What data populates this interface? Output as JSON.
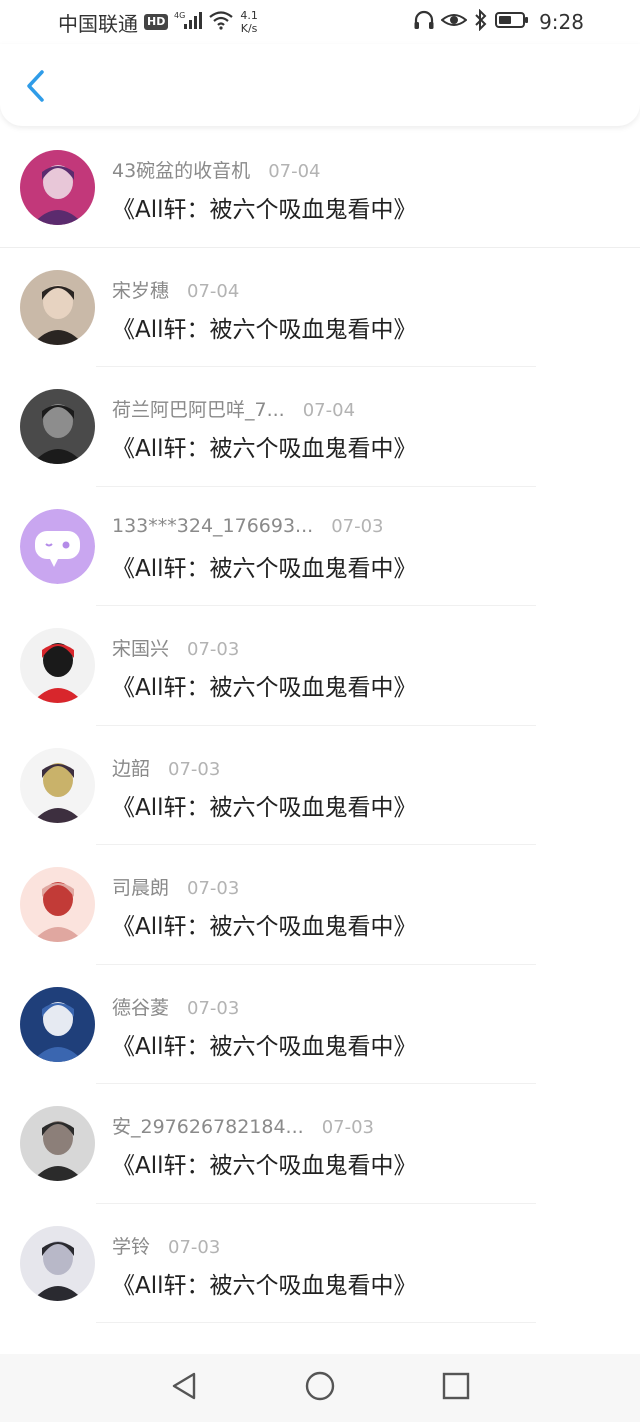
{
  "status_bar": {
    "carrier": "中国联通",
    "hd": "HD",
    "network": "4G",
    "speed_value": "4.1",
    "speed_unit": "K/s",
    "time": "9:28"
  },
  "header": {
    "back_icon": "chevron-left-icon"
  },
  "colors": {
    "accent": "#2f9ce8",
    "name": "#8a8a8a",
    "date": "#b3b3b3",
    "title": "#222222"
  },
  "items": [
    {
      "name": "43碗盆的收音机",
      "date": "07-04",
      "title": "《All轩：被六个吸血鬼看中》",
      "avatar_colors": [
        "#c2387a",
        "#5b2b6e",
        "#e8c7d8"
      ]
    },
    {
      "name": "宋岁穗",
      "date": "07-04",
      "title": "《All轩：被六个吸血鬼看中》",
      "avatar_colors": [
        "#c9b9a8",
        "#2a2522",
        "#e7d3c1"
      ]
    },
    {
      "name": "荷兰阿巴阿巴咩_7...",
      "date": "07-04",
      "title": "《All轩：被六个吸血鬼看中》",
      "avatar_colors": [
        "#4a4a4a",
        "#1b1b1b",
        "#8d8d8d"
      ]
    },
    {
      "name": "133***324_176693...",
      "date": "07-03",
      "title": "《All轩：被六个吸血鬼看中》",
      "avatar_colors": [
        "#c9a6f0",
        "#b48be8",
        "#ffffff"
      ]
    },
    {
      "name": "宋国兴",
      "date": "07-03",
      "title": "《All轩：被六个吸血鬼看中》",
      "avatar_colors": [
        "#f2f2f2",
        "#d8262c",
        "#1a1a1a"
      ]
    },
    {
      "name": "边韶",
      "date": "07-03",
      "title": "《All轩：被六个吸血鬼看中》",
      "avatar_colors": [
        "#f4f4f4",
        "#3d2f3f",
        "#c9b26a"
      ]
    },
    {
      "name": "司晨朗",
      "date": "07-03",
      "title": "《All轩：被六个吸血鬼看中》",
      "avatar_colors": [
        "#fbe3dd",
        "#e0a7a0",
        "#c23b37"
      ]
    },
    {
      "name": "德谷菱",
      "date": "07-03",
      "title": "《All轩：被六个吸血鬼看中》",
      "avatar_colors": [
        "#1f3f7a",
        "#3a66b0",
        "#e6eaf2"
      ]
    },
    {
      "name": "安_297626782184...",
      "date": "07-03",
      "title": "《All轩：被六个吸血鬼看中》",
      "avatar_colors": [
        "#d7d7d7",
        "#2b2b2b",
        "#8c7f79"
      ]
    },
    {
      "name": "学铃",
      "date": "07-03",
      "title": "《All轩：被六个吸血鬼看中》",
      "avatar_colors": [
        "#e6e6ec",
        "#2a2a30",
        "#b8b8c8"
      ]
    }
  ],
  "nav_bar": {
    "back": "triangle-back-icon",
    "home": "circle-home-icon",
    "recents": "square-recents-icon"
  }
}
